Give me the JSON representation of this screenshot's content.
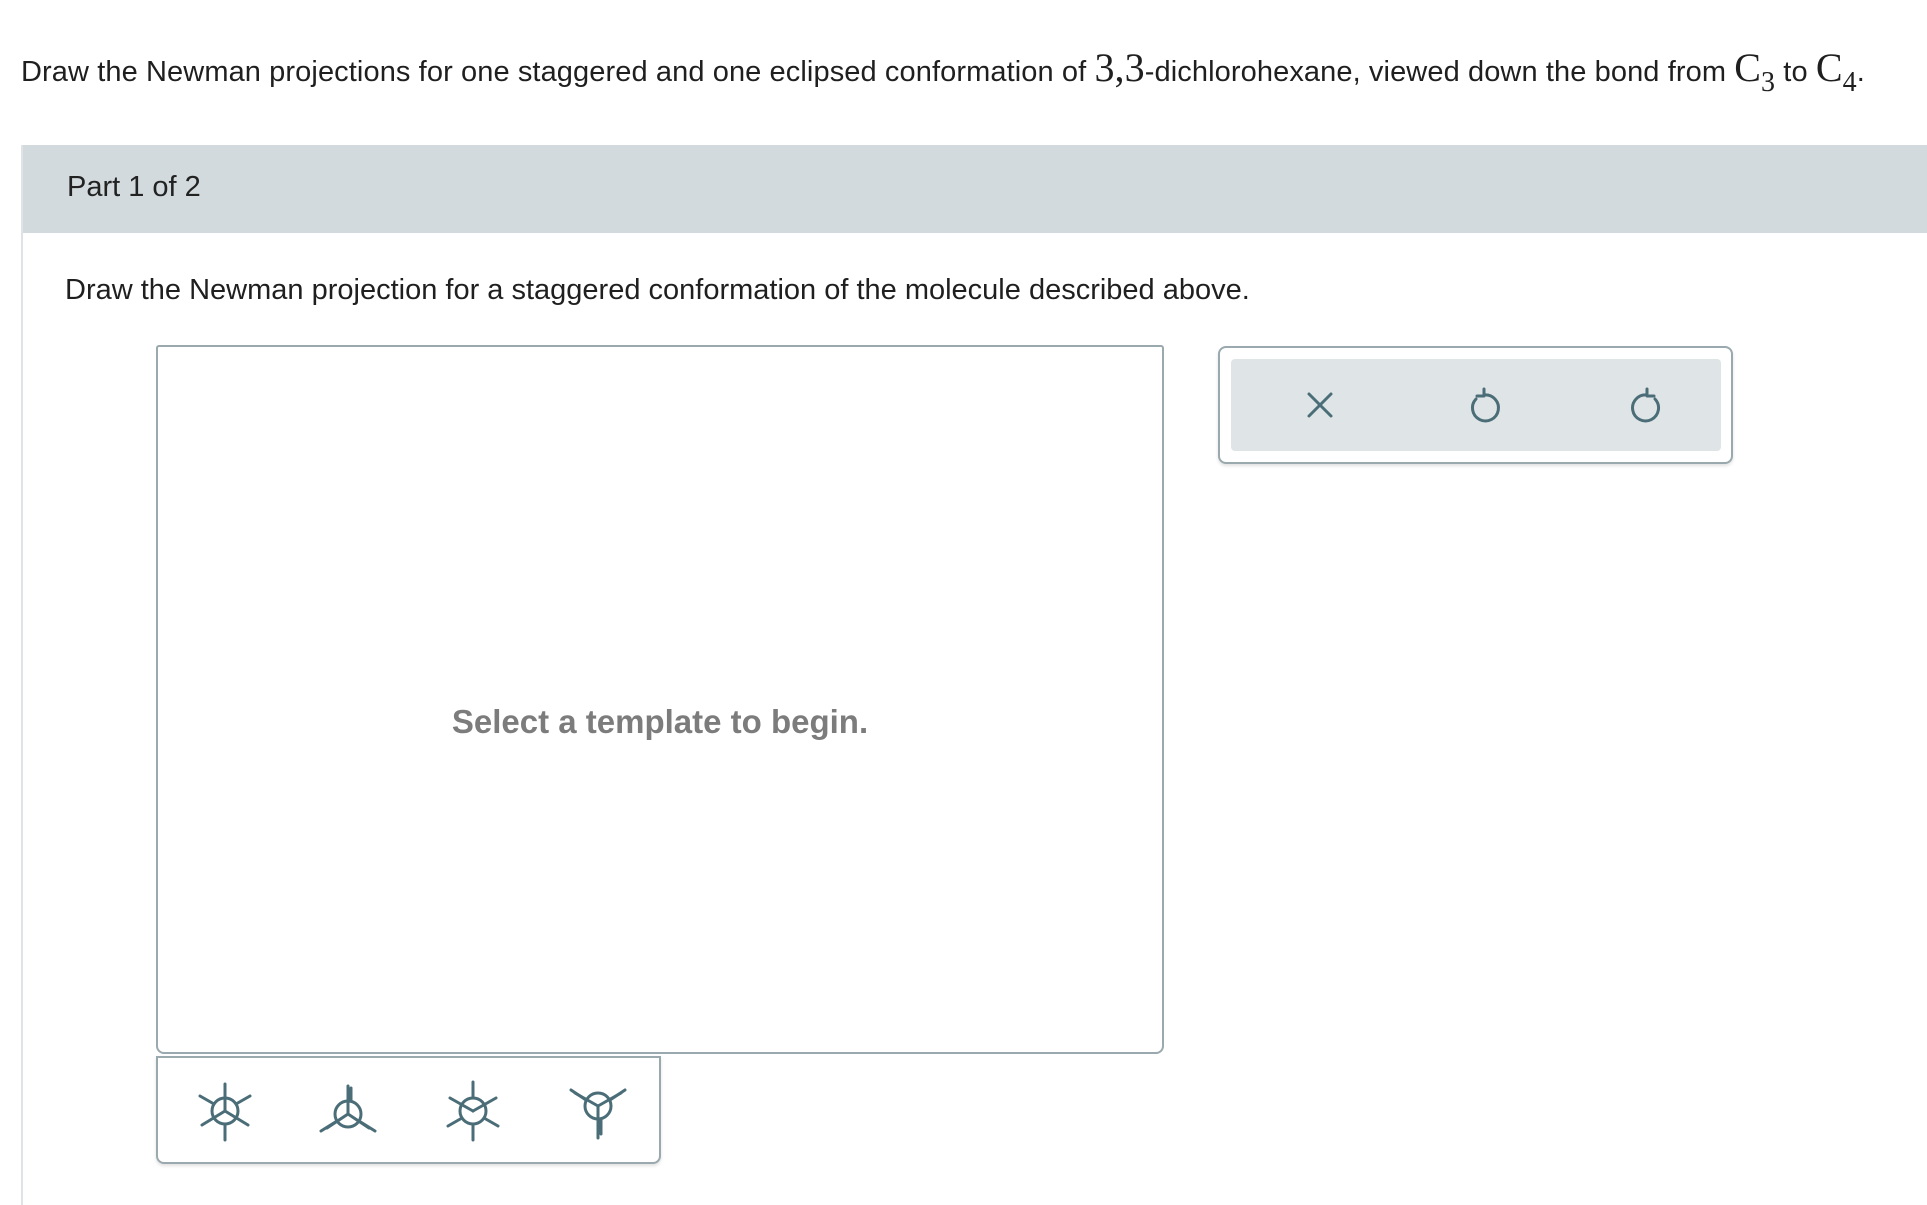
{
  "question": {
    "text_before": "Draw the Newman projections for one staggered and one eclipsed conformation of ",
    "compound_locants": "3,3",
    "text_compound": "-dichlorohexane, viewed down the bond from ",
    "c_symbol_1": "C",
    "c_sub_1": "3",
    "text_to": " to ",
    "c_symbol_2": "C",
    "c_sub_2": "4",
    "text_end": "."
  },
  "part": {
    "label": "Part 1 of 2",
    "prompt": "Draw the Newman projection for a staggered conformation of the molecule described above."
  },
  "canvas": {
    "empty_message": "Select a template to begin."
  },
  "toolbar": {
    "buttons": [
      {
        "icon": "close-icon",
        "action": "clear"
      },
      {
        "icon": "undo-icon",
        "action": "undo"
      },
      {
        "icon": "redo-icon",
        "action": "redo"
      }
    ]
  },
  "templates": [
    {
      "icon": "newman-staggered-template-icon"
    },
    {
      "icon": "newman-staggered-rotated-template-icon"
    },
    {
      "icon": "newman-eclipsed-template-icon"
    },
    {
      "icon": "newman-eclipsed-rotated-template-icon"
    }
  ],
  "colors": {
    "icon": "#4a6d77",
    "header_bg": "#d2dadd",
    "toolbar_bg": "#dfe5e7",
    "border": "#9aa9ad",
    "placeholder_text": "#7c7c7c"
  }
}
